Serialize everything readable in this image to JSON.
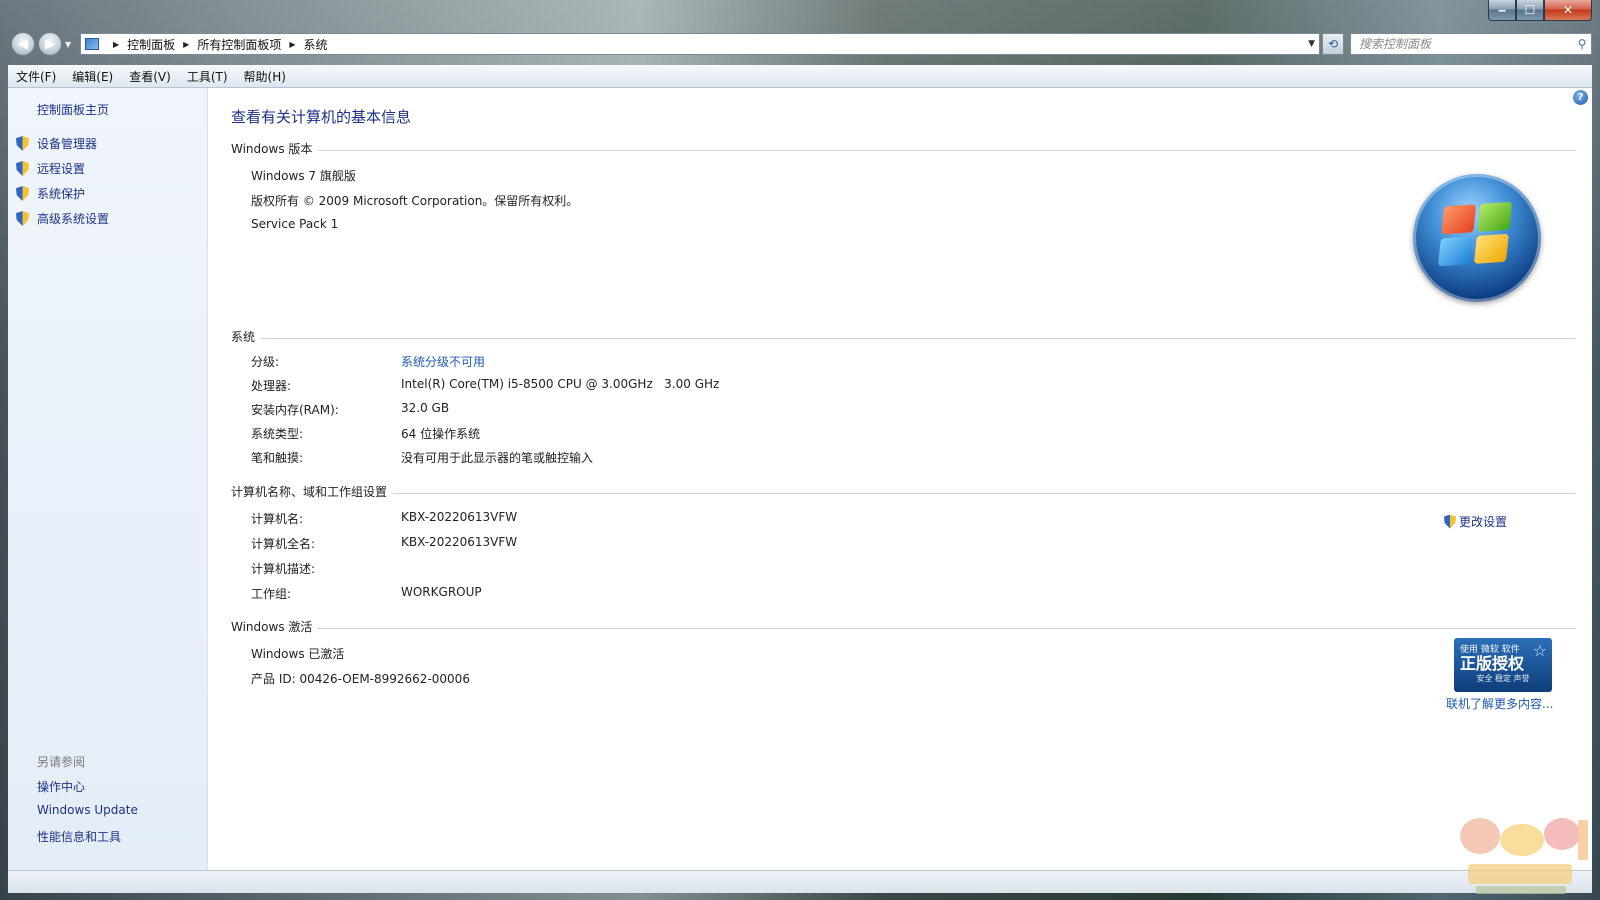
{
  "window": {
    "controls": {
      "minimize": "‒",
      "maximize": "☐",
      "close": "✕"
    }
  },
  "address_bar": {
    "breadcrumbs": [
      "控制面板",
      "所有控制面板项",
      "系统"
    ],
    "search_placeholder": "搜索控制面板"
  },
  "menu": [
    "文件(F)",
    "编辑(E)",
    "查看(V)",
    "工具(T)",
    "帮助(H)"
  ],
  "sidebar": {
    "home": "控制面板主页",
    "tasks": [
      {
        "label": "设备管理器",
        "icon": "shield-icon"
      },
      {
        "label": "远程设置",
        "icon": "shield-icon"
      },
      {
        "label": "系统保护",
        "icon": "shield-icon"
      },
      {
        "label": "高级系统设置",
        "icon": "shield-icon"
      }
    ],
    "see_also_title": "另请参阅",
    "see_also": [
      "操作中心",
      "Windows Update",
      "性能信息和工具"
    ]
  },
  "main": {
    "title": "查看有关计算机的基本信息",
    "windows_edition": {
      "header": "Windows 版本",
      "edition": "Windows 7 旗舰版",
      "copyright": "版权所有 © 2009 Microsoft Corporation。保留所有权利。",
      "service_pack": "Service Pack 1"
    },
    "system": {
      "header": "系统",
      "rows": [
        {
          "label": "分级:",
          "value": "系统分级不可用"
        },
        {
          "label": "处理器:",
          "value": "Intel(R) Core(TM) i5-8500 CPU @ 3.00GHz   3.00 GHz"
        },
        {
          "label": "安装内存(RAM):",
          "value": "32.0 GB"
        },
        {
          "label": "系统类型:",
          "value": "64 位操作系统"
        },
        {
          "label": "笔和触摸:",
          "value": "没有可用于此显示器的笔或触控输入"
        }
      ]
    },
    "computer": {
      "header": "计算机名称、域和工作组设置",
      "change_settings": "更改设置",
      "rows": [
        {
          "label": "计算机名:",
          "value": "KBX-20220613VFW"
        },
        {
          "label": "计算机全名:",
          "value": "KBX-20220613VFW"
        },
        {
          "label": "计算机描述:",
          "value": ""
        },
        {
          "label": "工作组:",
          "value": "WORKGROUP"
        }
      ]
    },
    "activation": {
      "header": "Windows 激活",
      "status": "Windows 已激活",
      "product_id": "产品 ID: 00426-OEM-8992662-00006",
      "genuine_badge": {
        "top": "使用 微软 软件",
        "main": "正版授权",
        "sub": "安全 稳定 声誉"
      },
      "learn_more": "联机了解更多内容..."
    }
  },
  "colors": {
    "link": "#1e3287",
    "title": "#1e3287",
    "sidebar_bg": "#e4edf8"
  }
}
